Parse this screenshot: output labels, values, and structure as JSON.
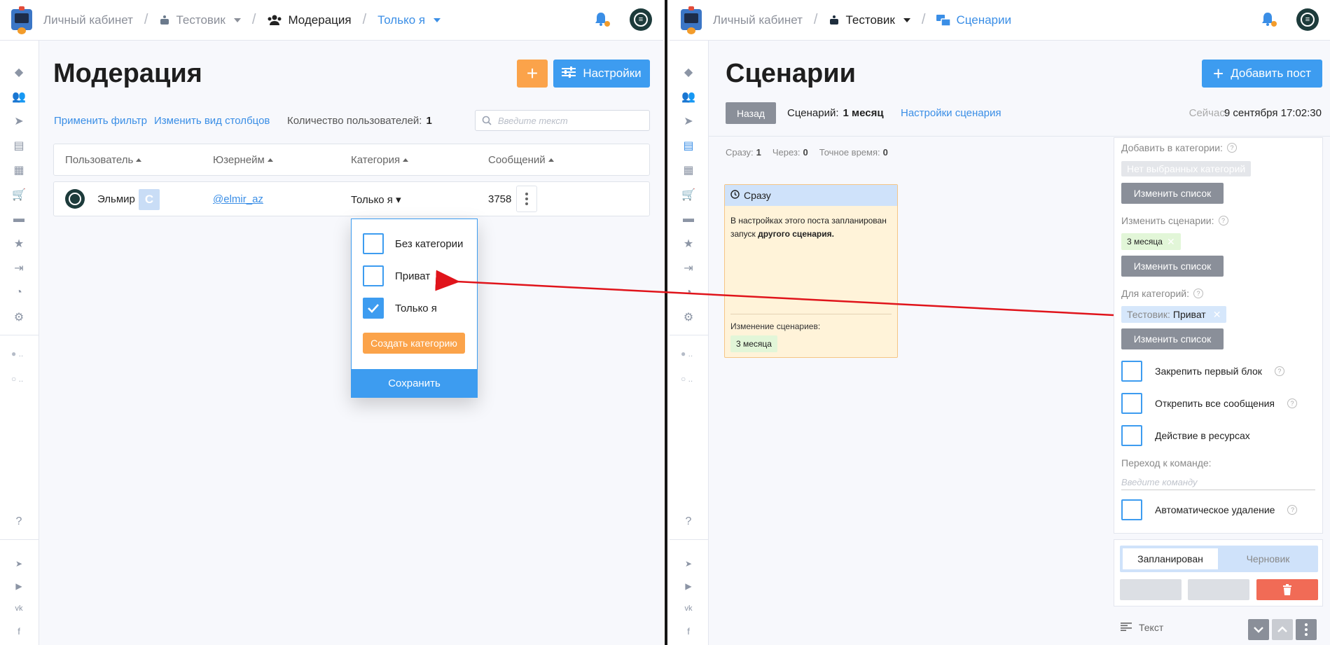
{
  "left": {
    "breadcrumb": {
      "cabinet": "Личный кабинет",
      "bot": "Тестовик",
      "section": "Модерация",
      "filter": "Только я"
    },
    "page_title": "Модерация",
    "settings_label": "Настройки",
    "apply_filter": "Применить фильтр",
    "change_columns": "Изменить вид столбцов",
    "users_count_label": "Количество пользователей:",
    "users_count": "1",
    "search_placeholder": "Введите текст",
    "table": {
      "headers": [
        "Пользователь",
        "Юзернейм",
        "Категория",
        "Сообщений"
      ],
      "row": {
        "name": "Эльмир",
        "letter": "С",
        "username": "@elmir_az",
        "category": "Только я",
        "messages": "3758"
      }
    },
    "dropdown": {
      "options": [
        {
          "label": "Без категории",
          "checked": false
        },
        {
          "label": "Приват",
          "checked": false
        },
        {
          "label": "Только я",
          "checked": true
        }
      ],
      "create_label": "Создать категорию",
      "save_label": "Сохранить"
    }
  },
  "right": {
    "breadcrumb": {
      "cabinet": "Личный кабинет",
      "bot": "Тестовик",
      "section": "Сценарии"
    },
    "page_title": "Сценарии",
    "add_post": "Добавить пост",
    "back": "Назад",
    "scenario_label": "Сценарий:",
    "scenario_value": "1 месяц",
    "scenario_settings": "Настройки сценария",
    "now_label": "Сейчас:",
    "now_value": "9 сентября 17:02:30",
    "timing": {
      "now_label": "Сразу:",
      "now_value": "1",
      "after_label": "Через:",
      "after_value": "0",
      "exact_label": "Точное время:",
      "exact_value": "0"
    },
    "card": {
      "header": "Сразу",
      "text_plain": "В настройках этого поста запланирован запуск ",
      "text_bold": "другого сценария.",
      "change_label": "Изменение сценариев:",
      "tag": "3 месяца"
    },
    "panel": {
      "add_categories_label": "Добавить в категории:",
      "no_categories": "Нет выбранных категорий",
      "change_list": "Изменить список",
      "change_scenarios_label": "Изменить сценарии:",
      "scenario_tag": "3 месяца",
      "for_categories_label": "Для категорий:",
      "cat_prefix": "Тестовик:",
      "cat_value": "Приват",
      "checks": [
        "Закрепить первый блок",
        "Открепить все сообщения",
        "Действие в ресурсах"
      ],
      "goto_label": "Переход к команде:",
      "goto_placeholder": "Введите команду",
      "auto_delete": "Автоматическое удаление"
    },
    "status": {
      "planned": "Запланирован",
      "draft": "Черновик"
    },
    "text_block": "Текст"
  },
  "colors": {
    "accent_blue": "#3d9cf0",
    "accent_orange": "#fba34a",
    "danger_red": "#f16b56",
    "arrow_red": "#e0141b"
  }
}
